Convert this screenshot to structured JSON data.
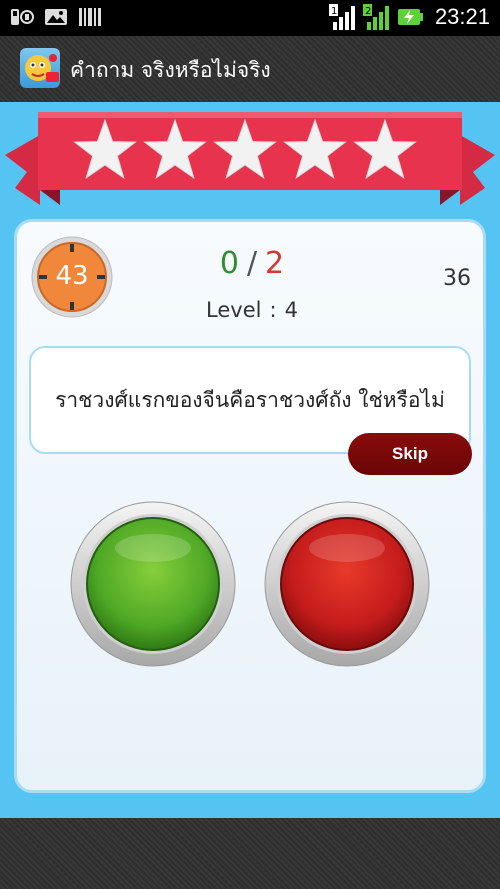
{
  "status_bar": {
    "time": "23:21",
    "sim1_label": "1",
    "sim2_label": "2",
    "icons": [
      "usb-debug-icon",
      "gallery-icon",
      "barcode-icon",
      "signal-sim1-icon",
      "signal-sim2-icon",
      "battery-charging-icon"
    ]
  },
  "app": {
    "title": "คำถาม จริงหรือไม่จริง",
    "icon": "app-logo-icon"
  },
  "stars": {
    "filled": 0,
    "total": 5
  },
  "game": {
    "timer": "43",
    "correct": "0",
    "separator": "/",
    "wrong": "2",
    "level_label": "Level",
    "level_colon": ":",
    "level_value": "4",
    "counter": "36",
    "question": "ราชวงศ์แรกของจีนคือราชวงศ์ถัง ใช่หรือไม่",
    "skip_label": "Skip"
  },
  "colors": {
    "background": "#56c4f2",
    "ribbon": "#e8334f",
    "true_button": "#5cb82a",
    "false_button": "#d42020",
    "skip_button": "#7a0808"
  }
}
